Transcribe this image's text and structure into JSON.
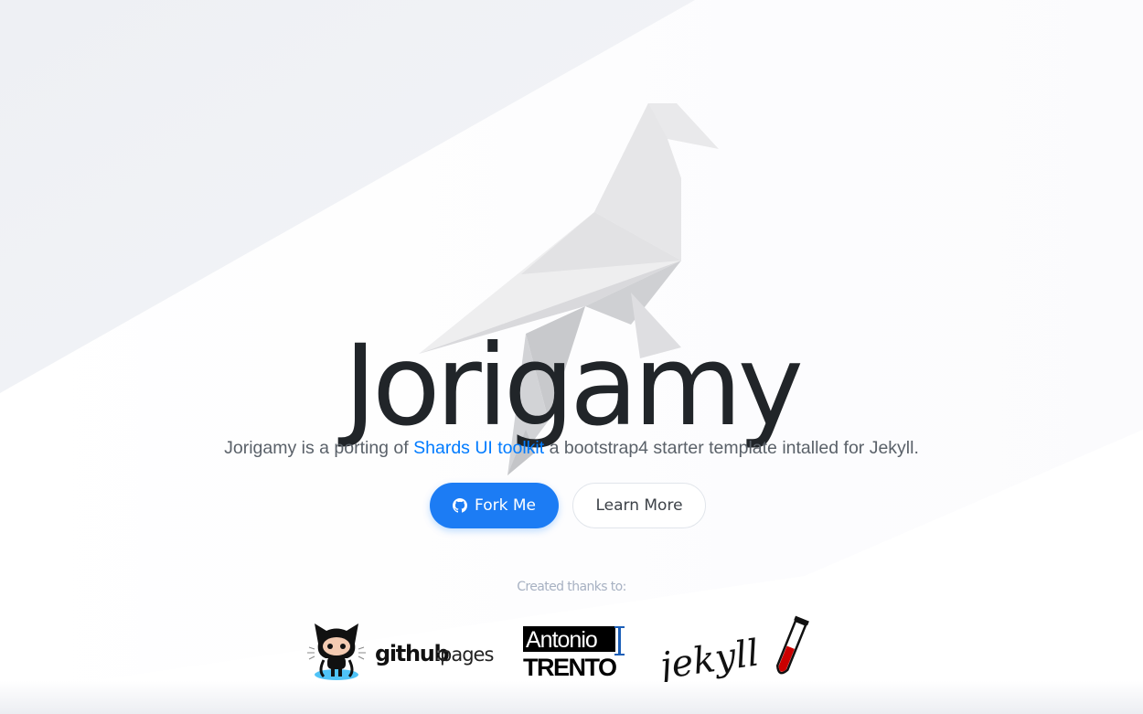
{
  "hero": {
    "title": "Jorigamy",
    "subtitle_pre": "Jorigamy is a porting of ",
    "subtitle_link": "Shards UI toolkit",
    "subtitle_post": " a bootstrap4 starter template intalled for Jekyll."
  },
  "buttons": {
    "fork_label": "Fork Me",
    "fork_icon": "github-icon",
    "learn_more_label": "Learn More"
  },
  "credits": {
    "title": "Created thanks to:",
    "logos": {
      "github_pages": {
        "word1": "github",
        "separator": ":",
        "word2": "pages"
      },
      "antonio_trento": {
        "line1": "Antonio",
        "line2": "TRENTO"
      },
      "jekyll": {
        "name": "jekyll"
      }
    }
  },
  "colors": {
    "primary": "#1c7cf4",
    "link": "#007bff",
    "title": "#212529",
    "subtitle": "#5a6169",
    "muted": "#a7b1c2",
    "jekyll_red": "#cc0000"
  }
}
